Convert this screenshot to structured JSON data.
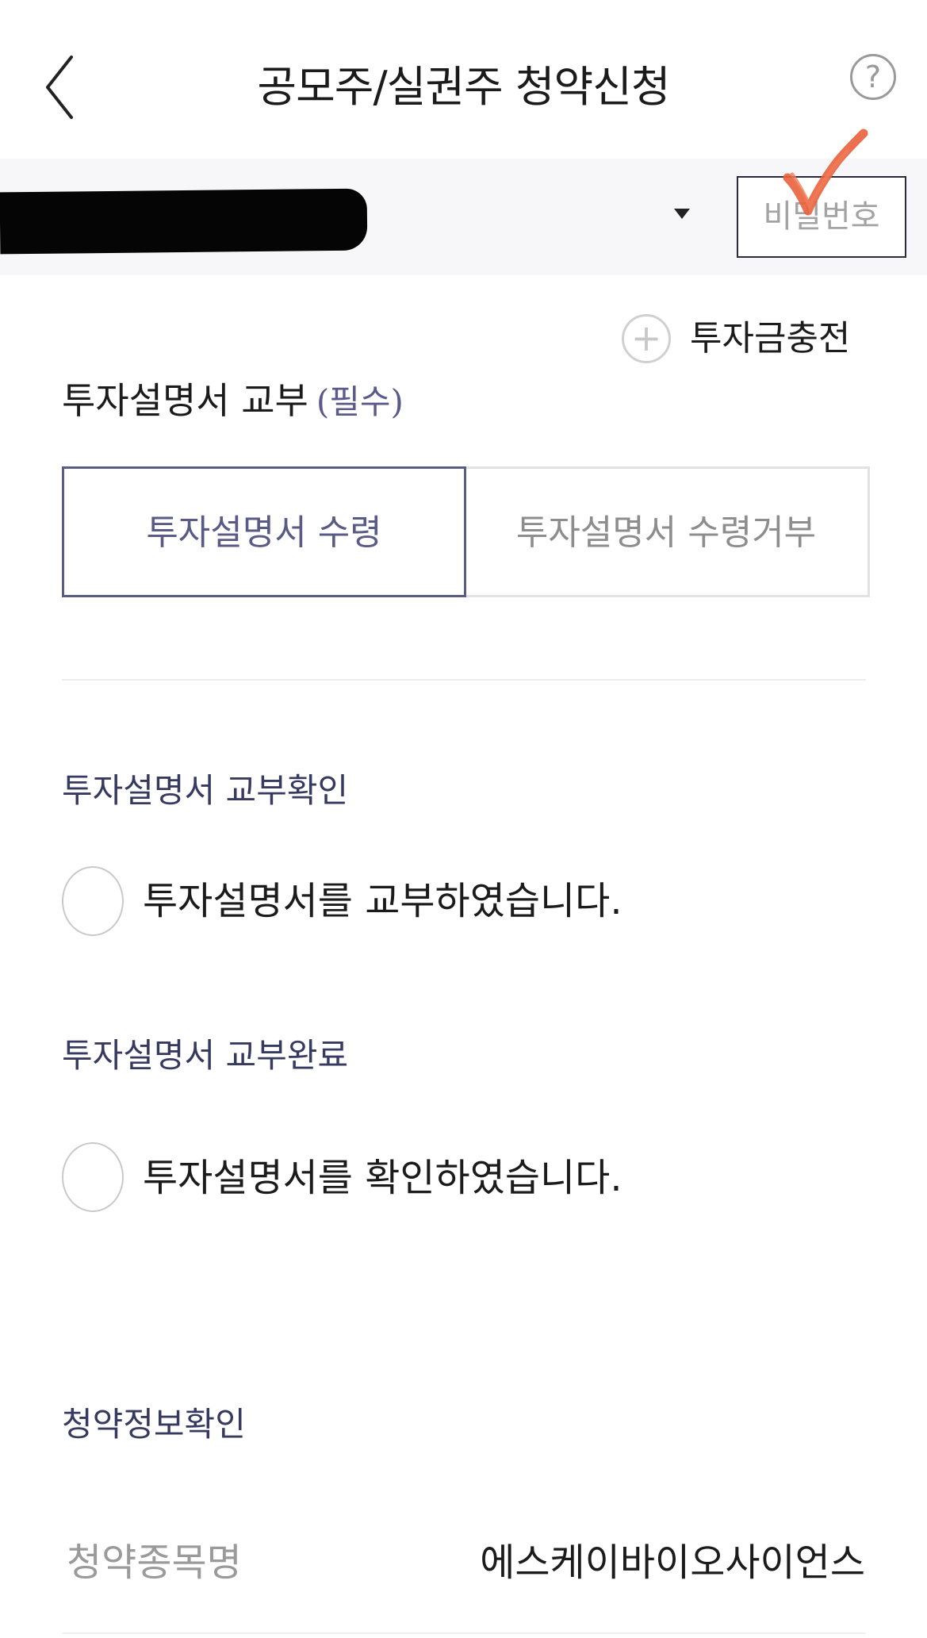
{
  "header": {
    "title": "공모주/실권주 청약신청",
    "help_symbol": "?"
  },
  "account_bar": {
    "account_number": "",
    "password_label": "비밀번호"
  },
  "charge": {
    "plus_symbol": "+",
    "label": "투자금충전"
  },
  "prospectus": {
    "title": "투자설명서 교부",
    "required": "(필수)",
    "options": [
      "투자설명서 수령",
      "투자설명서 수령거부"
    ],
    "selected_index": 0
  },
  "delivery_confirm": {
    "title": "투자설명서 교부확인",
    "checkbox_label": "투자설명서를 교부하였습니다.",
    "checked": false
  },
  "delivery_complete": {
    "title": "투자설명서 교부완료",
    "checkbox_label": "투자설명서를 확인하였습니다.",
    "checked": false
  },
  "subscription_info": {
    "title": "청약정보확인",
    "rows": [
      {
        "label": "청약종목명",
        "value": "에스케이바이오사이언스"
      }
    ]
  },
  "colors": {
    "accent": "#5b5c82",
    "annotation": "#e8603c"
  }
}
